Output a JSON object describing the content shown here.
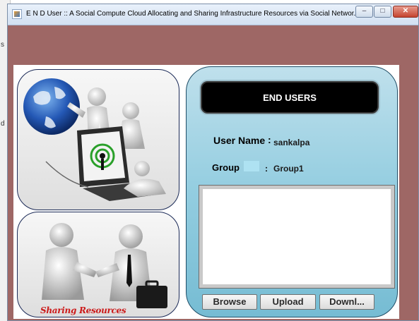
{
  "window": {
    "title": "E N D User :: A Social Compute Cloud Allocating and Sharing Infrastructure Resources via Social Networ...",
    "controls": {
      "minimize": "–",
      "maximize": "□",
      "close": "✕"
    }
  },
  "background_marks": [
    "s",
    "d"
  ],
  "images": {
    "top": {
      "icon": "people-with-globe-and-laptop-illustration"
    },
    "bottom": {
      "icon": "handshake-illustration",
      "caption": "Sharing Resources"
    }
  },
  "form": {
    "header": "END USERS",
    "user_name_label": "User Name",
    "user_name_separator": ":",
    "user_name_value": "sankalpa",
    "group_label": "Group",
    "group_separator": ":",
    "group_value": "Group1",
    "buttons": {
      "browse": "Browse",
      "upload": "Upload",
      "download": "Downl..."
    }
  },
  "colors": {
    "frame_background": "#9e6765",
    "panel_border": "#1b2a57",
    "form_gradient_top": "#bfe0ec",
    "form_gradient_bottom": "#76bcd3",
    "caption": "#cc1a1a"
  }
}
